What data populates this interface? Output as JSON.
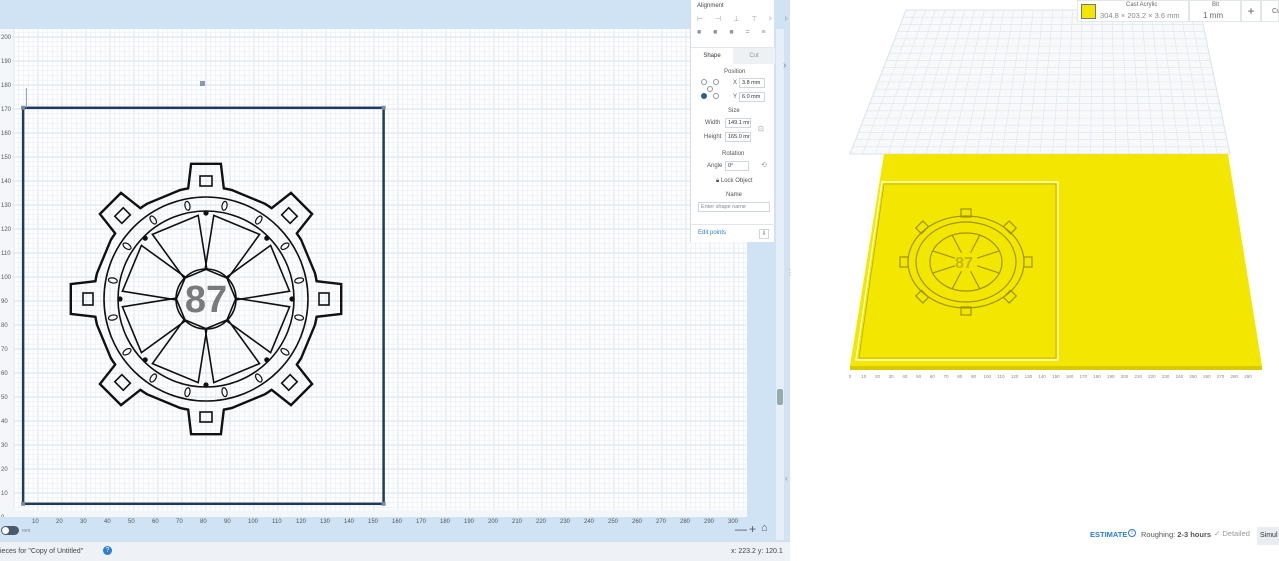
{
  "canvas": {
    "y_ticks": [
      "200",
      "190",
      "180",
      "170",
      "160",
      "150",
      "140",
      "130",
      "120",
      "110",
      "100",
      "90",
      "80",
      "70",
      "60",
      "50",
      "40",
      "30",
      "20",
      "10",
      "0"
    ],
    "x_ticks": [
      "10",
      "20",
      "30",
      "40",
      "50",
      "60",
      "70",
      "80",
      "90",
      "100",
      "110",
      "120",
      "130",
      "140",
      "150",
      "160",
      "170",
      "180",
      "190",
      "200",
      "210",
      "220",
      "230",
      "240",
      "250",
      "260",
      "270",
      "280",
      "290",
      "300"
    ],
    "design_text": "87",
    "toggle_label": "mm"
  },
  "panel": {
    "alignment_title": "Alignment",
    "align_row1": "⊢ ⊣ ⊥ ⊤ ⊦ ⊧",
    "align_row2": "■ ■ ■  = ≡",
    "tab_shape": "Shape",
    "tab_cut": "Cut",
    "position_label": "Position",
    "x_label": "X",
    "x_value": "3.8 mm",
    "y_label": "Y",
    "y_value": "6.0 mm",
    "size_label": "Size",
    "width_label": "Width",
    "width_value": "149.1 mr",
    "height_label": "Height",
    "height_value": "165.0 mr",
    "rotation_label": "Rotation",
    "angle_label": "Angle",
    "angle_value": "0°",
    "lock_object": "Lock Object",
    "name_label": "Name",
    "name_placeholder": "Enter shape name",
    "edit_points": "Edit points"
  },
  "status": {
    "pieces_text": "ieces for \"Copy of Untitled\"",
    "coords": "x: 223.2 y: 120.1"
  },
  "zoom": {
    "minus": "—",
    "plus": "+",
    "home": "⌂"
  },
  "preview": {
    "material_name": "Cast Acrylic",
    "material_dims": "304.8 × 203.2 × 3.6 mm",
    "material_color": "#f3e600",
    "bit_label": "Bit",
    "bit_value": "1 mm",
    "add_label": "+",
    "cut_label": "Cu",
    "estimate_label": "ESTIMATE",
    "roughing_label": "Roughing:",
    "roughing_value": "2-3 hours",
    "detailed_label": "✓ Detailed",
    "simulate_label": "Simul",
    "x_ticks": [
      "0",
      "10",
      "20",
      "30",
      "40",
      "50",
      "60",
      "70",
      "80",
      "90",
      "100",
      "110",
      "120",
      "130",
      "140",
      "150",
      "160",
      "170",
      "180",
      "190",
      "200",
      "210",
      "220",
      "230",
      "240",
      "250",
      "260",
      "270",
      "280",
      "290"
    ]
  }
}
